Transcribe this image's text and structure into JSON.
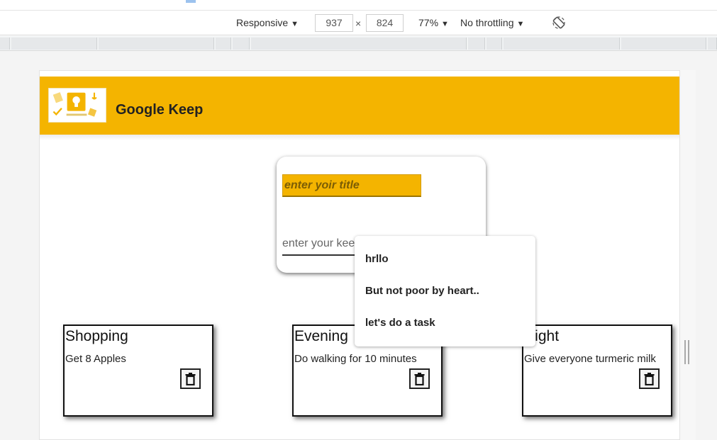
{
  "devtools": {
    "device": "Responsive",
    "width": "937",
    "times": "×",
    "height": "824",
    "zoom": "77%",
    "throttling": "No throttling",
    "rotate_icon": "rotate-icon"
  },
  "app": {
    "title": "Google Keep",
    "logo_icon": "google-keep-logo"
  },
  "form": {
    "title_placeholder": "enter yoir title",
    "content_placeholder": "enter your keep"
  },
  "notes": [
    {
      "title": "Shopping",
      "body": "Get 8 Apples"
    },
    {
      "title": "Evening",
      "body": "Do walking for 10 minutes"
    },
    {
      "title": "Night",
      "body": "Give everyone turmeric milk"
    }
  ],
  "suggestions": [
    "hrllo",
    "But not poor by heart..",
    "let's do a task"
  ],
  "colors": {
    "accent": "#f4b400",
    "text": "#222222",
    "card_border": "#111111"
  },
  "icons": {
    "delete": "trash-icon",
    "caret": "caret-down-icon"
  }
}
